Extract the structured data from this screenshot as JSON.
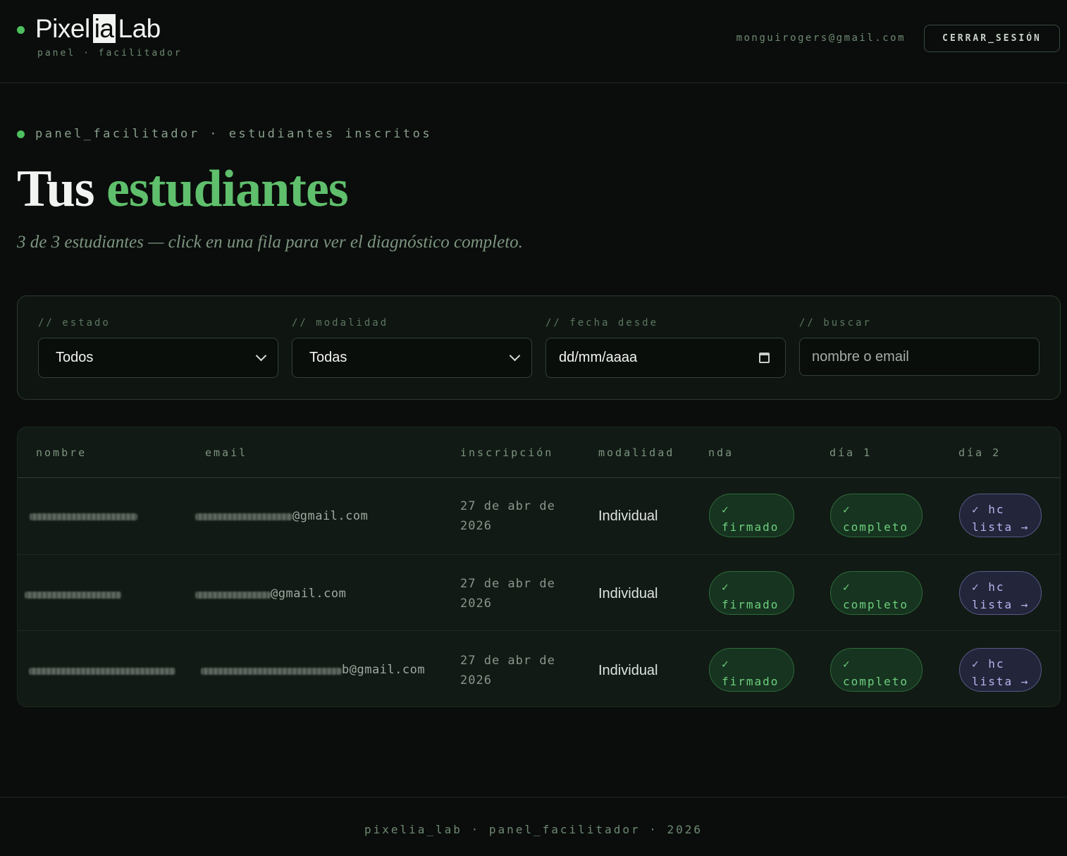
{
  "header": {
    "brand_left": "Pixel",
    "brand_mid": "ia",
    "brand_right": "Lab",
    "brand_sub": "panel · facilitador",
    "user_email": "monguirogers@gmail.com",
    "logout_label": "CERRAR_SESIÓN"
  },
  "hero": {
    "breadcrumb": "panel_facilitador · estudiantes inscritos",
    "title_plain": "Tus",
    "title_accent": "estudiantes",
    "subtitle": "3 de 3 estudiantes — click en una fila para ver el diagnóstico completo."
  },
  "filters": {
    "estado": {
      "label": "// estado",
      "value": "Todos"
    },
    "modalidad": {
      "label": "// modalidad",
      "value": "Todas"
    },
    "fecha": {
      "label": "// fecha desde",
      "placeholder": "dd/mm/aaaa"
    },
    "buscar": {
      "label": "// buscar",
      "placeholder": "nombre o email"
    }
  },
  "table": {
    "columns": [
      "nombre",
      "email",
      "inscripción",
      "modalidad",
      "nda",
      "día 1",
      "día 2"
    ],
    "rows": [
      {
        "email_visible": "@gmail.com",
        "inscripcion": "27 de abr de 2026",
        "modalidad": "Individual",
        "nda": {
          "check": "✓",
          "text": "firmado"
        },
        "dia1": {
          "check": "✓",
          "text": "completo"
        },
        "dia2": {
          "check": "✓ hc",
          "text": "lista →"
        }
      },
      {
        "email_visible": "@gmail.com",
        "inscripcion": "27 de abr de 2026",
        "modalidad": "Individual",
        "nda": {
          "check": "✓",
          "text": "firmado"
        },
        "dia1": {
          "check": "✓",
          "text": "completo"
        },
        "dia2": {
          "check": "✓ hc",
          "text": "lista →"
        }
      },
      {
        "email_visible": "b@gmail.com",
        "inscripcion": "27 de abr de 2026",
        "modalidad": "Individual",
        "nda": {
          "check": "✓",
          "text": "firmado"
        },
        "dia1": {
          "check": "✓",
          "text": "completo"
        },
        "dia2": {
          "check": "✓ hc",
          "text": "lista →"
        }
      }
    ]
  },
  "footer": {
    "text": "pixelia_lab · panel_facilitador · 2026"
  },
  "colors": {
    "accent": "#5fbf6c",
    "background": "#0a0d0b",
    "badge_purple": "#b9b2f0"
  }
}
